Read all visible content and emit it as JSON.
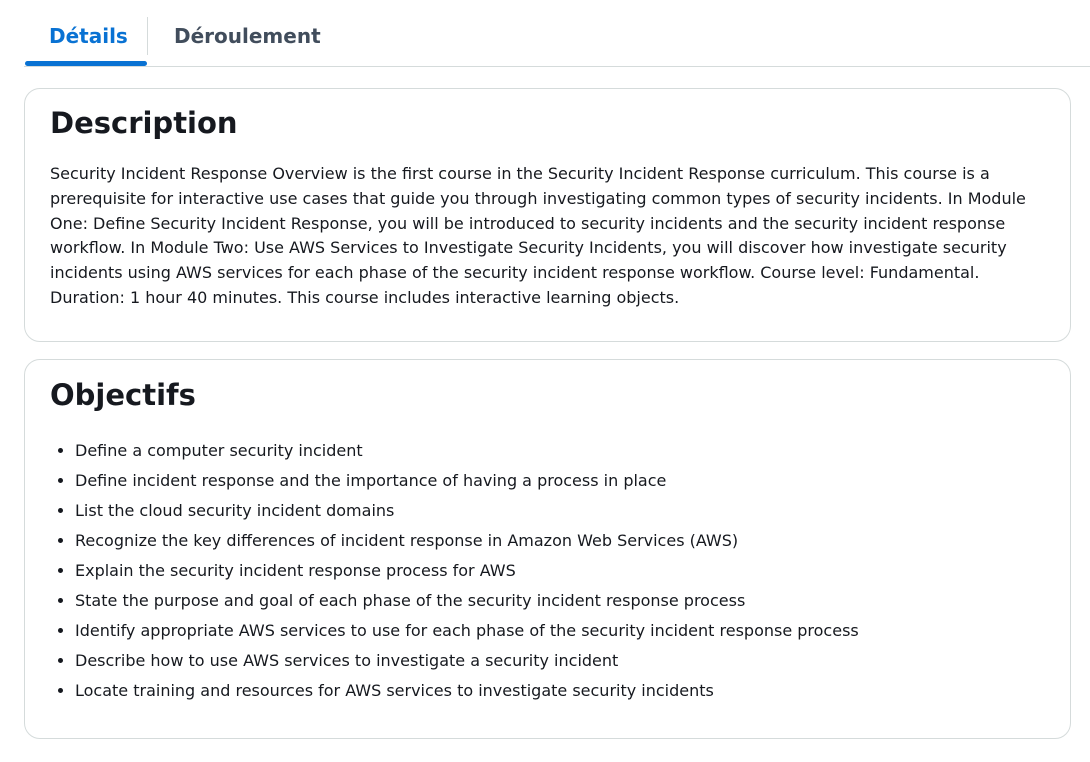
{
  "tabs": {
    "details": "Détails",
    "deroulement": "Déroulement"
  },
  "description": {
    "title": "Description",
    "text": "Security Incident Response Overview is the first course in the Security Incident Response curriculum. This course is a prerequisite for interactive use cases that guide you through investigating common types of security incidents. In Module One: Define Security Incident Response, you will be introduced to security incidents and the security incident response workflow. In Module Two: Use AWS Services to Investigate Security Incidents, you will discover how investigate security incidents using AWS services for each phase of the security incident response workflow. Course level: Fundamental. Duration: 1 hour 40 minutes. This course includes interactive learning objects."
  },
  "objectives": {
    "title": "Objectifs",
    "items": [
      "Define a computer security incident",
      "Define incident response and the importance of having a process in place",
      "List the cloud security incident domains",
      "Recognize the key differences of incident response in Amazon Web Services (AWS)",
      "Explain the security incident response process for AWS",
      "State the purpose and goal of each phase of the security incident response process",
      "Identify appropriate AWS services to use for each phase of the security incident response process",
      "Describe how to use AWS services to investigate a security incident",
      "Locate training and resources for AWS services to investigate security incidents"
    ]
  },
  "colors": {
    "accent": "#0972d3",
    "border": "#d5dbdb",
    "text": "#16191f",
    "inactive_tab": "#414d5c"
  }
}
